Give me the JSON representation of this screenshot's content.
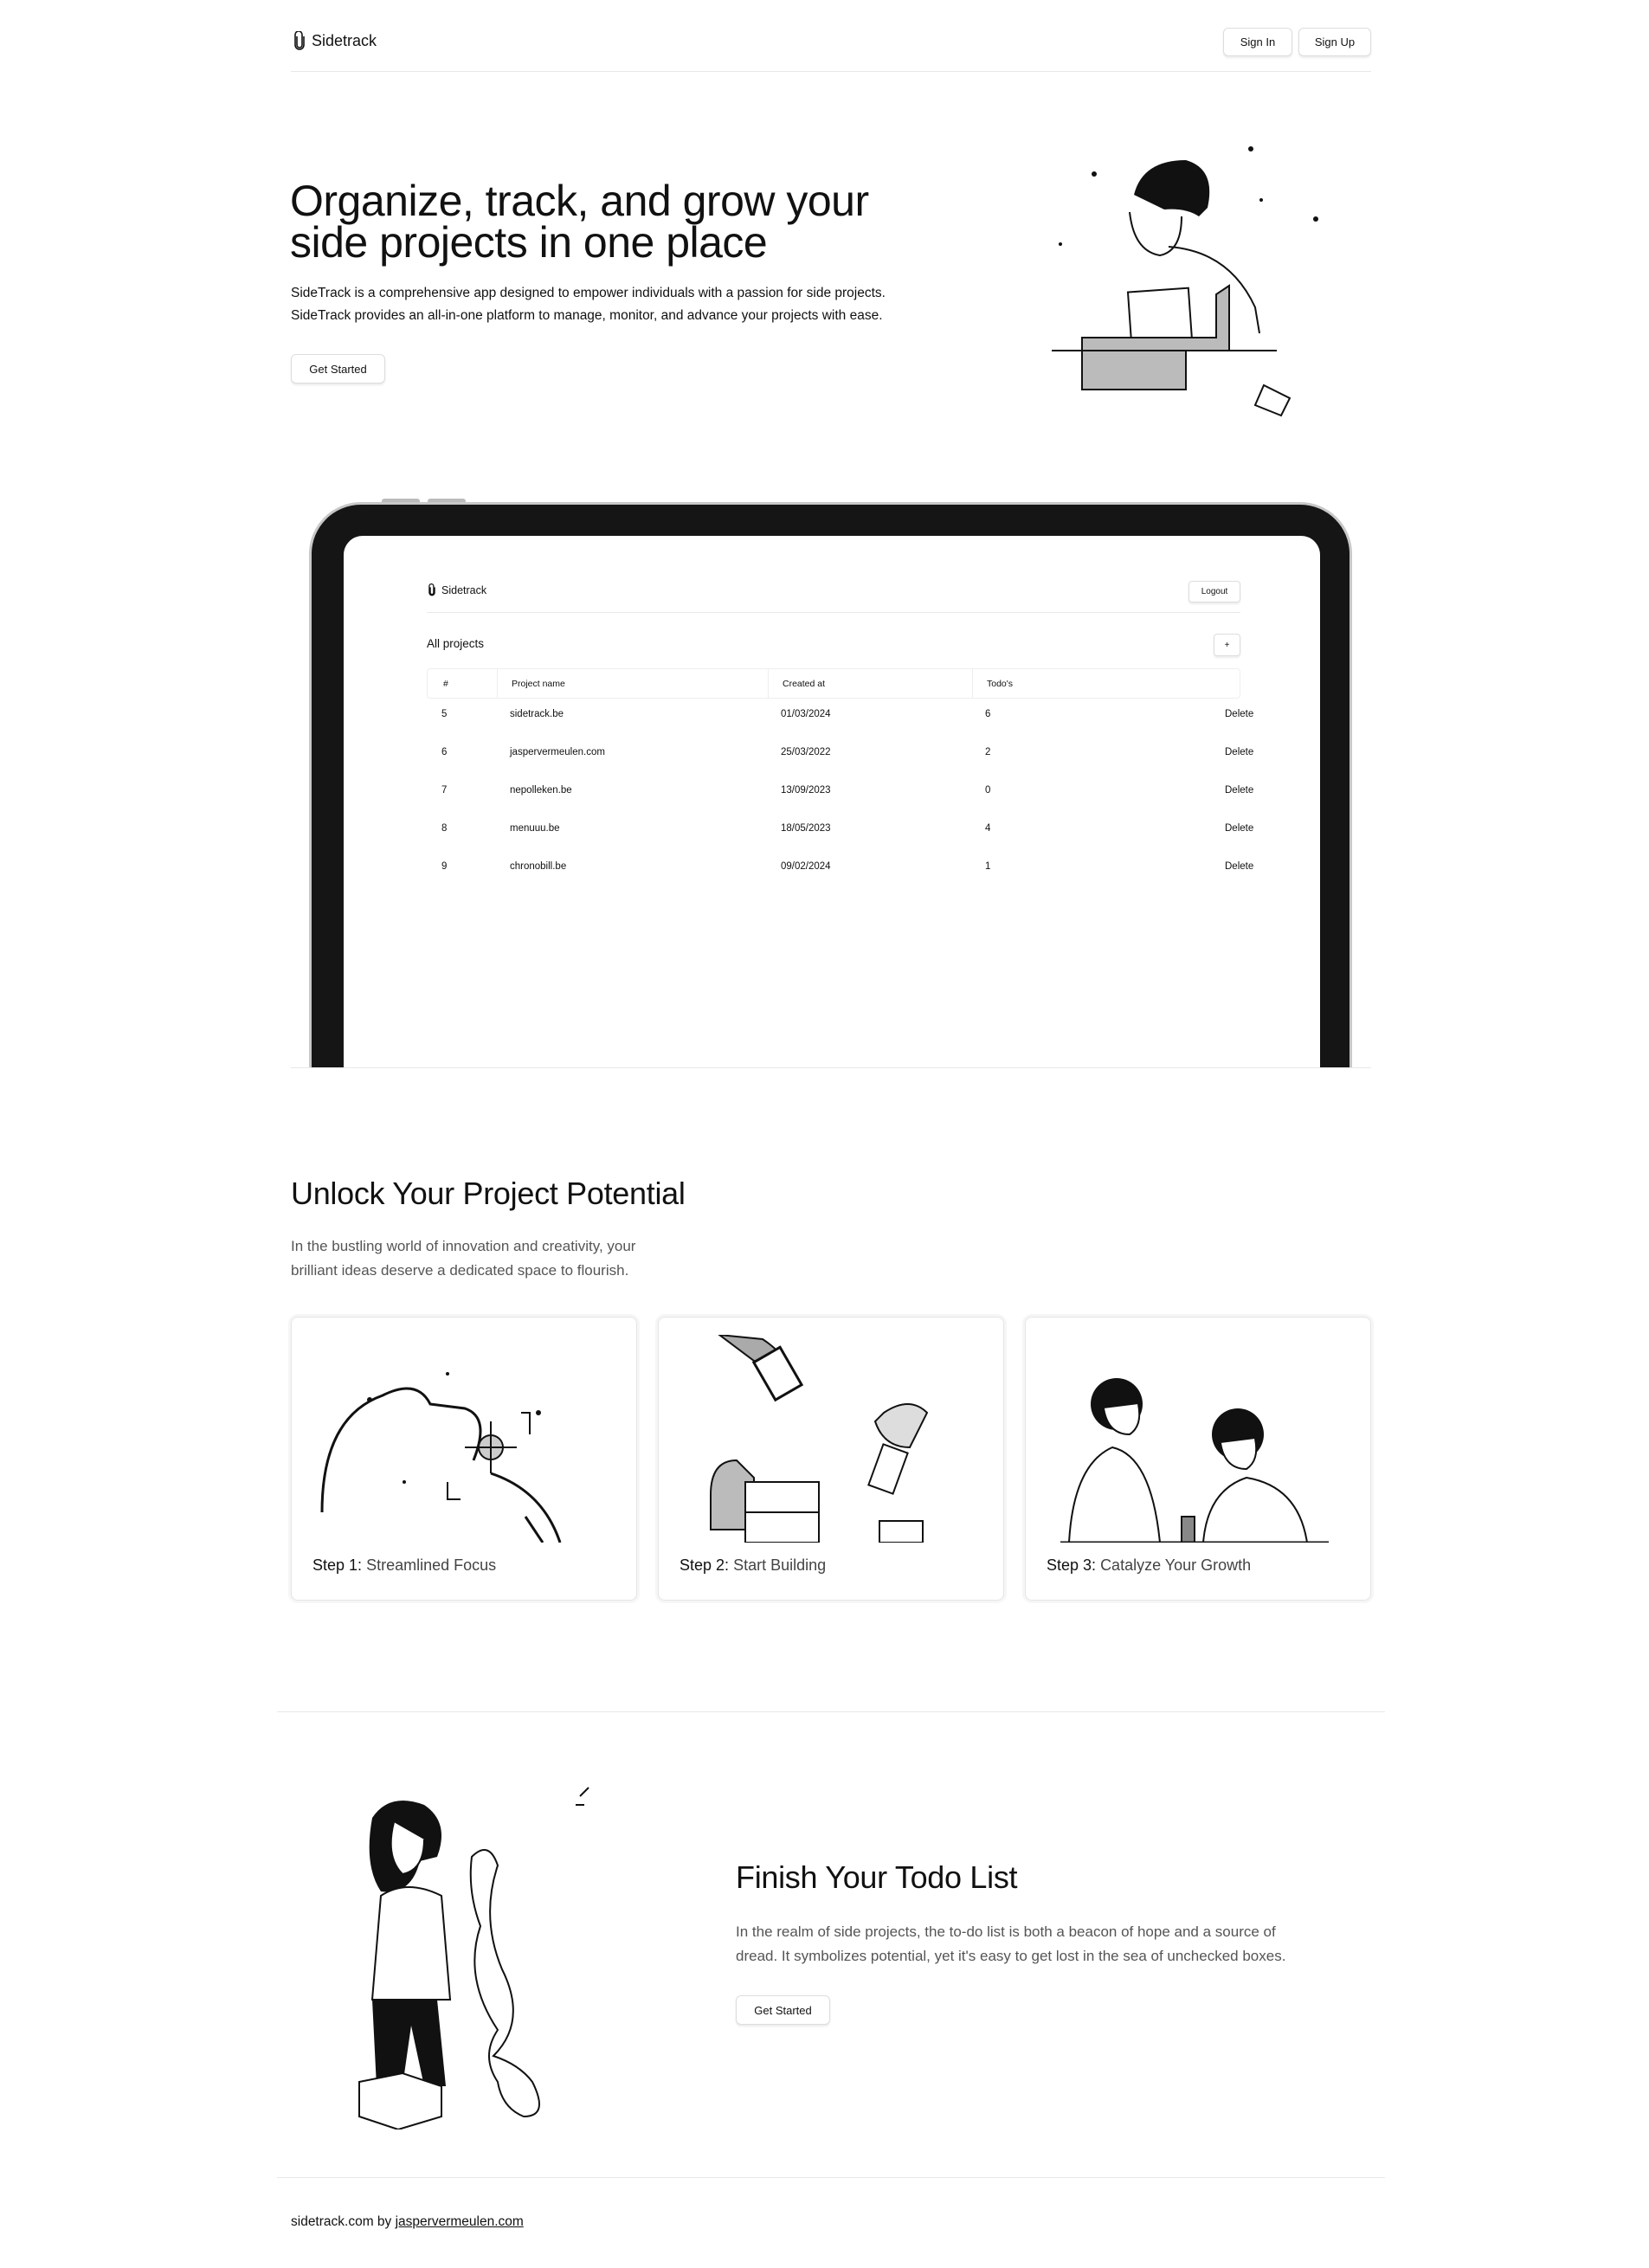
{
  "nav": {
    "brand": "Sidetrack",
    "sign_in": "Sign In",
    "sign_up": "Sign Up"
  },
  "hero": {
    "title_line1": "Organize, track, and grow your",
    "title_line2": "side projects in one place",
    "desc_line1": "SideTrack is a comprehensive app designed to empower individuals with a passion for side projects.",
    "desc_line2": "SideTrack provides an all-in-one platform to manage, monitor, and advance your projects with ease.",
    "cta": "Get Started"
  },
  "app_preview": {
    "brand": "Sidetrack",
    "logout": "Logout",
    "section_title": "All projects",
    "add_button": "+",
    "columns": [
      "#",
      "Project name",
      "Created at",
      "Todo's"
    ],
    "rows": [
      {
        "id": "5",
        "name": "sidetrack.be",
        "created": "01/03/2024",
        "todos": "6",
        "action": "Delete"
      },
      {
        "id": "6",
        "name": "jaspervermeulen.com",
        "created": "25/03/2022",
        "todos": "2",
        "action": "Delete"
      },
      {
        "id": "7",
        "name": "nepolleken.be",
        "created": "13/09/2023",
        "todos": "0",
        "action": "Delete"
      },
      {
        "id": "8",
        "name": "menuuu.be",
        "created": "18/05/2023",
        "todos": "4",
        "action": "Delete"
      },
      {
        "id": "9",
        "name": "chronobill.be",
        "created": "09/02/2024",
        "todos": "1",
        "action": "Delete"
      }
    ]
  },
  "features": {
    "title": "Unlock Your Project Potential",
    "desc_line1": "In the bustling world of innovation and creativity, your",
    "desc_line2": "brilliant ideas deserve a dedicated space to flourish.",
    "steps": [
      {
        "prefix": "Step 1:",
        "label": "Streamlined Focus"
      },
      {
        "prefix": "Step 2:",
        "label": "Start Building"
      },
      {
        "prefix": "Step 3:",
        "label": "Catalyze Your Growth"
      }
    ]
  },
  "todo": {
    "title": "Finish Your Todo List",
    "desc_line1": "In the realm of side projects, the to-do list is both a beacon of hope and a source of",
    "desc_line2": "dread. It symbolizes potential, yet it's easy to get lost in the sea of unchecked boxes.",
    "cta": "Get Started"
  },
  "footer": {
    "text": "sidetrack.com by ",
    "link": "jaspervermeulen.com"
  }
}
